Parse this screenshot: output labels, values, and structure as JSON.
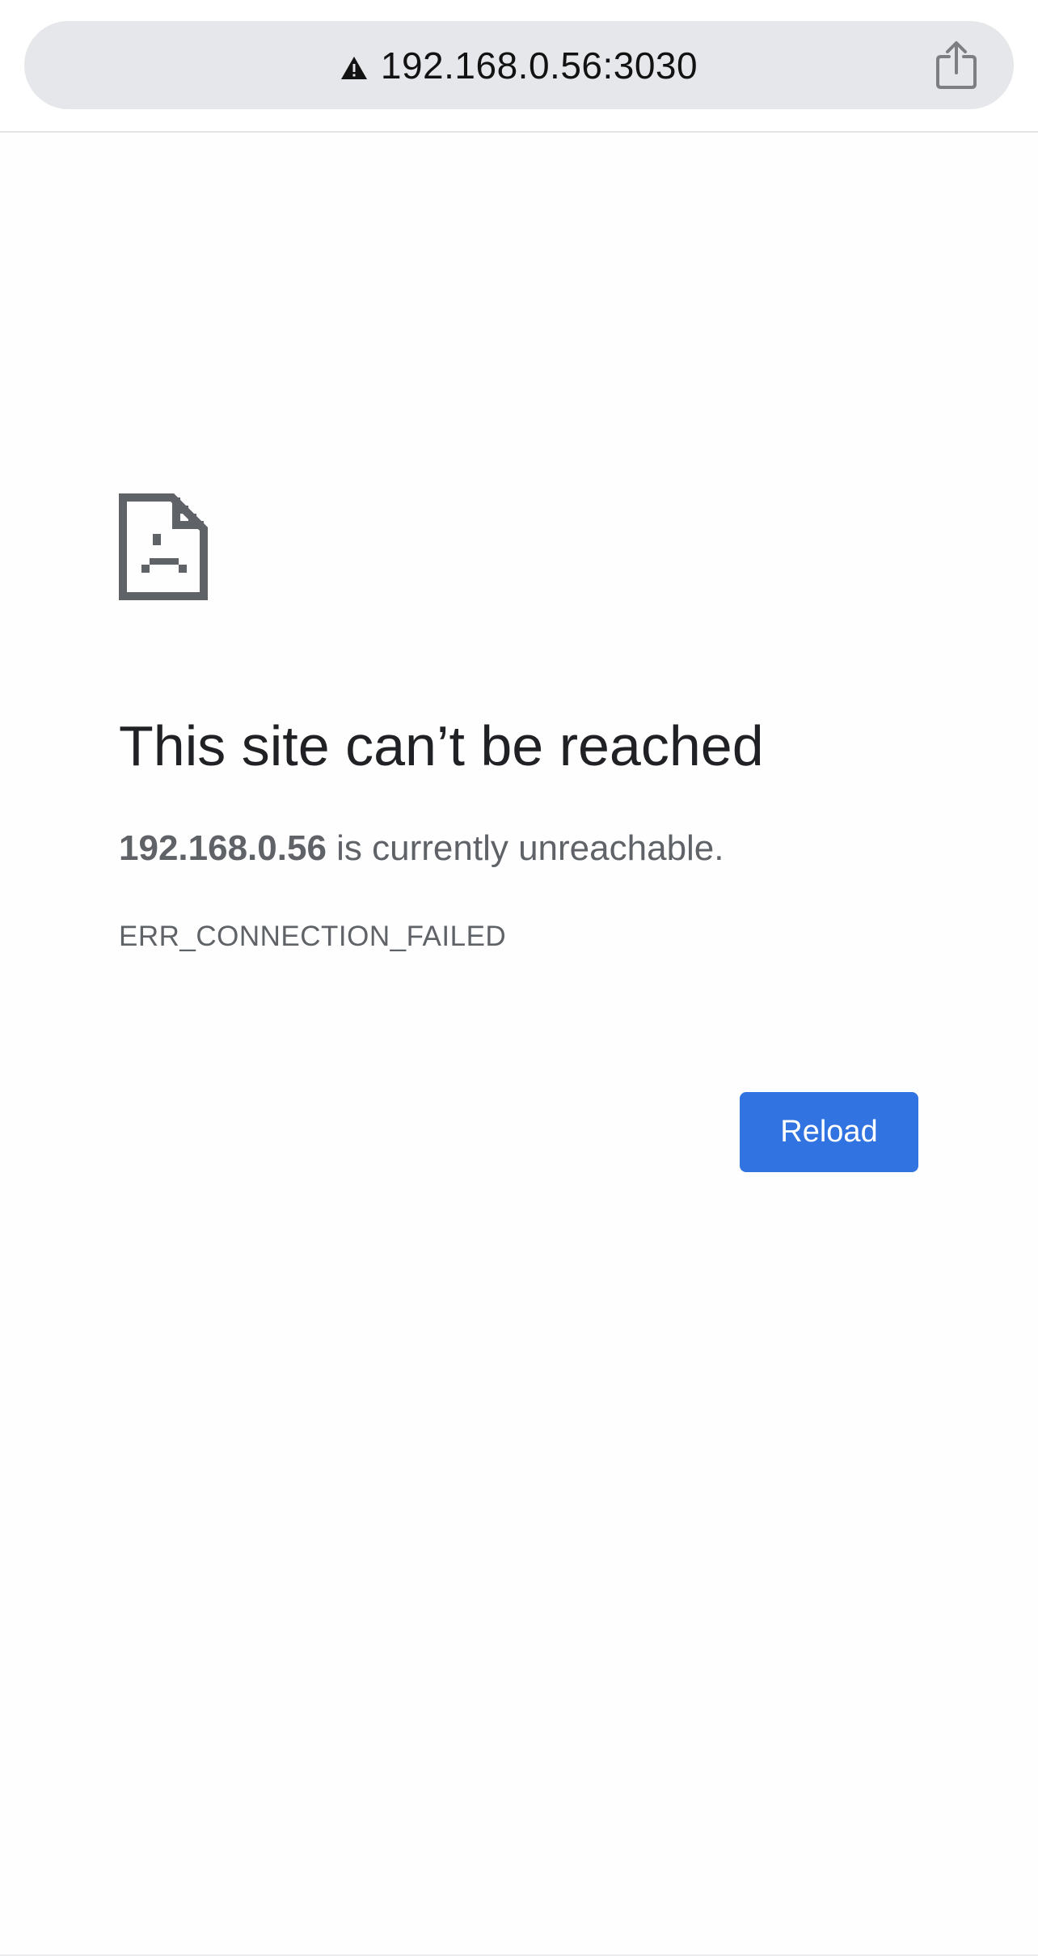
{
  "address_bar": {
    "url": "192.168.0.56:3030",
    "warning_icon": "warning-triangle-icon",
    "share_icon": "share-icon"
  },
  "error": {
    "icon": "sad-page-icon",
    "title": "This site can’t be reached",
    "host": "192.168.0.56",
    "description_suffix": " is currently unreachable.",
    "code": "ERR_CONNECTION_FAILED",
    "reload_label": "Reload"
  },
  "colors": {
    "accent": "#3173e0",
    "urlbar_bg": "#e6e7ea",
    "title_text": "#202124",
    "secondary_text": "#5f6368"
  }
}
